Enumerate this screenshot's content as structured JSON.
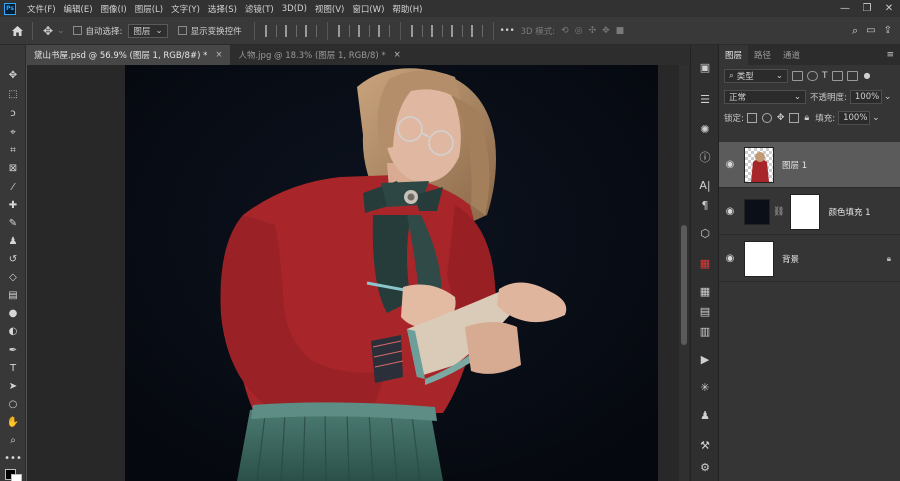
{
  "app": {
    "logo": "Ps"
  },
  "menu": [
    "文件(F)",
    "编辑(E)",
    "图像(I)",
    "图层(L)",
    "文字(Y)",
    "选择(S)",
    "滤镜(T)",
    "3D(D)",
    "视图(V)",
    "窗口(W)",
    "帮助(H)"
  ],
  "window_controls": [
    "—",
    "❐",
    "✕"
  ],
  "options": {
    "auto_select_label": "自动选择:",
    "auto_select_value": "图层",
    "transform_label": "显示变换控件",
    "mode_3d_label": "3D 模式:",
    "more": "•••"
  },
  "tabs": [
    {
      "label": "黛山书屋.psd @ 56.9% (图层 1, RGB/8#) *",
      "close": "×"
    },
    {
      "label": "人物.jpg @ 18.3% (图层 1, RGB/8) *",
      "close": "×"
    }
  ],
  "panel": {
    "tabs": [
      "图层",
      "路径",
      "通道"
    ],
    "filter_kind": "类型",
    "blend_mode": "正常",
    "opacity_label": "不透明度:",
    "opacity_value": "100%",
    "lock_label": "锁定:",
    "fill_label": "填充:",
    "fill_value": "100%"
  },
  "layers": [
    {
      "name": "图层 1",
      "selected": true
    },
    {
      "name": "颜色填充 1",
      "selected": false
    },
    {
      "name": "背景",
      "selected": false
    }
  ],
  "colors": {
    "blouse": "#a8262a",
    "skirt": "#3d6a62",
    "scarf": "#263c3a",
    "hair": "#b89572",
    "skin": "#e0b7a0",
    "canvas_bg": "#070b12"
  },
  "icons": {
    "home": "home-icon",
    "move": "move-tool-icon",
    "search": "search-icon",
    "eye": "eye-icon",
    "lock": "lock-icon"
  }
}
